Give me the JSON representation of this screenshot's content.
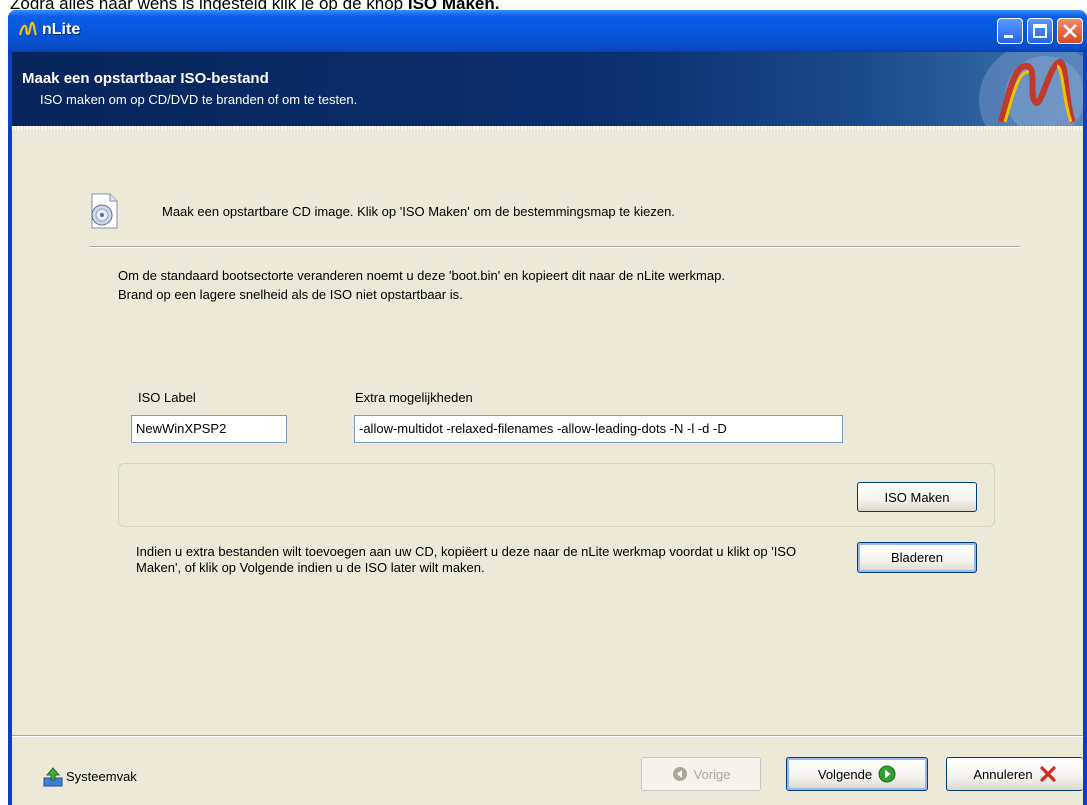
{
  "caption": {
    "prefix": "Zodra alles naar wens is ingesteld klik je op de knop",
    "emphasis": "ISO Maken."
  },
  "window": {
    "title": "nLite",
    "controls": [
      "minimize",
      "maximize",
      "close"
    ]
  },
  "header": {
    "title": "Maak een opstartbaar ISO-bestand",
    "subtitle": "ISO maken om op CD/DVD te branden of om te testen."
  },
  "info": {
    "icon": "cd-image-icon",
    "text": "Maak een opstartbare CD image. Klik op 'ISO Maken' om de bestemmingsmap te kiezen."
  },
  "note": {
    "line1": "Om de standaard bootsectorte veranderen noemt u deze 'boot.bin' en kopieert dit naar de nLite werkmap.",
    "line2": "Brand op een lagere snelheid als de ISO niet opstartbaar is."
  },
  "iso_label": {
    "label": "ISO Label",
    "value": "NewWinXPSP2"
  },
  "extra_options": {
    "label": "Extra mogelijkheden",
    "value": "-allow-multidot -relaxed-filenames -allow-leading-dots -N -l -d -D"
  },
  "buttons": {
    "make_iso": "ISO Maken",
    "browse": "Bladeren",
    "previous": "Vorige",
    "next": "Volgende",
    "cancel": "Annuleren"
  },
  "description": "Indien u extra bestanden wilt toevoegen aan uw CD, kopiëert u deze naar de nLite werkmap voordat u klikt op 'ISO Maken', of klik op Volgende indien u de ISO later wilt maken.",
  "footer": {
    "systray_label": "Systeemvak"
  },
  "colors": {
    "titlebar": "#0a4fc8",
    "client_bg": "#ece9d8",
    "header_bg": "#0a2f6e"
  }
}
